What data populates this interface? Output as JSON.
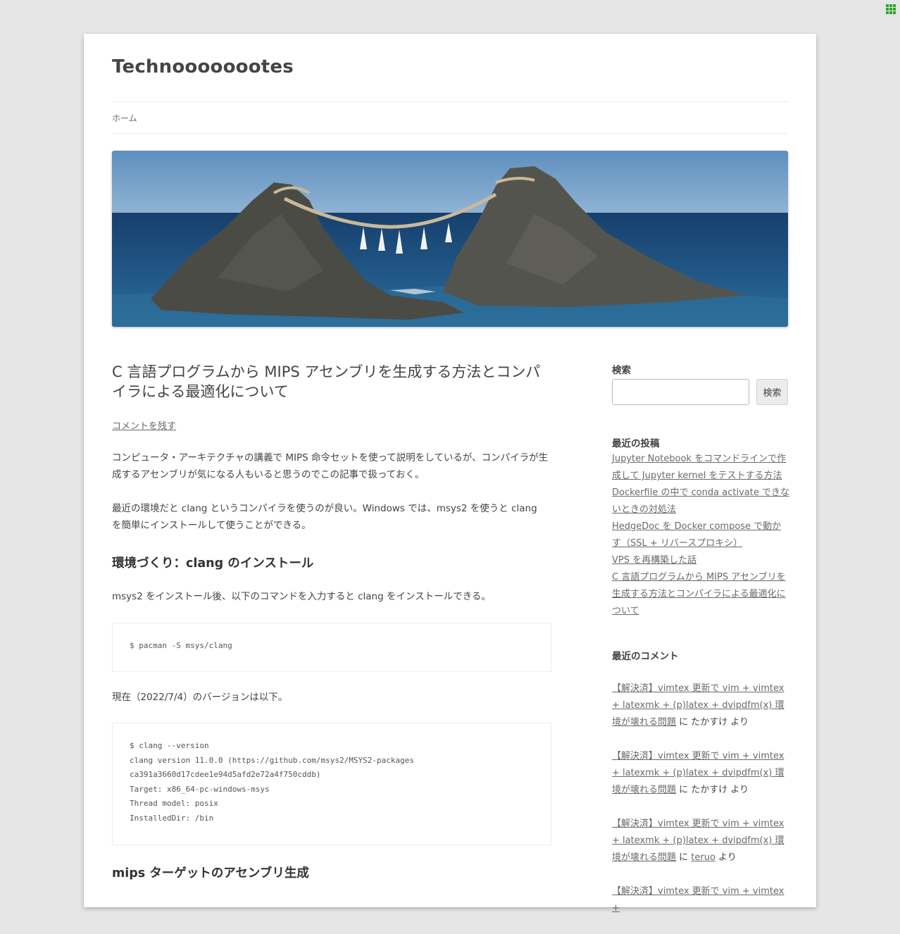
{
  "site": {
    "title": "Technoooooootes"
  },
  "nav": {
    "home": "ホーム"
  },
  "post": {
    "title": "C 言語プログラムから MIPS アセンブリを生成する方法とコンパイラによる最適化について",
    "comment_link": "コメントを残す",
    "p1": "コンピュータ・アーキテクチャの講義で MIPS 命令セットを使って説明をしているが、コンパイラが生成するアセンブリが気になる人もいると思うのでこの記事で扱っておく。",
    "p2": "最近の環境だと clang というコンパイラを使うのが良い。Windows では、msys2 を使うと clang を簡単にインストールして使うことができる。",
    "h_install": "環境づくり：clang のインストール",
    "p3": "msys2 をインストール後、以下のコマンドを入力すると clang をインストールできる。",
    "code1": "$ pacman -S msys/clang",
    "p4": "現在（2022/7/4）のバージョンは以下。",
    "code2": "$ clang --version\nclang version 11.0.0 (https://github.com/msys2/MSYS2-packages\nca391a3660d17cdee1e94d5afd2e72a4f750cddb)\nTarget: x86_64-pc-windows-msys\nThread model: posix\nInstalledDir: /bin",
    "h_mips": "mips ターゲットのアセンブリ生成"
  },
  "sidebar": {
    "search_title": "検索",
    "search_button": "検索",
    "search_value": "",
    "recent_posts_title": "最近の投稿",
    "recent_posts": [
      "Jupyter Notebook をコマンドラインで作成して Jupyter kernel をテストする方法",
      "Dockerfile の中で conda activate できないときの対処法",
      "HedgeDoc を Docker compose で動かす（SSL + リバースプロキシ）",
      "VPS を再構築した話",
      "C 言語プログラムから MIPS アセンブリを生成する方法とコンパイラによる最適化について"
    ],
    "recent_comments_title": "最近のコメント",
    "recent_comments": [
      {
        "post": "【解決済】vimtex 更新で vim + vimtex + latexmk + (p)latex + dvipdfm(x) 環境が壊れる問題",
        "on": " に ",
        "author": "たかすけ",
        "suffix": " より",
        "author_link": false
      },
      {
        "post": "【解決済】vimtex 更新で vim + vimtex + latexmk + (p)latex + dvipdfm(x) 環境が壊れる問題",
        "on": " に ",
        "author": "たかすけ",
        "suffix": " より",
        "author_link": false
      },
      {
        "post": "【解決済】vimtex 更新で vim + vimtex + latexmk + (p)latex + dvipdfm(x) 環境が壊れる問題",
        "on": " に ",
        "author": "teruo",
        "suffix": " より",
        "author_link": true
      },
      {
        "post": "【解決済】vimtex 更新で vim + vimtex +",
        "on": "",
        "author": "",
        "suffix": "",
        "author_link": false
      }
    ]
  },
  "colors": {
    "sky": "#5f8fbd",
    "sea": "#1a4f7f",
    "rock": "#4a4a45",
    "link": "#6a6a6a"
  }
}
